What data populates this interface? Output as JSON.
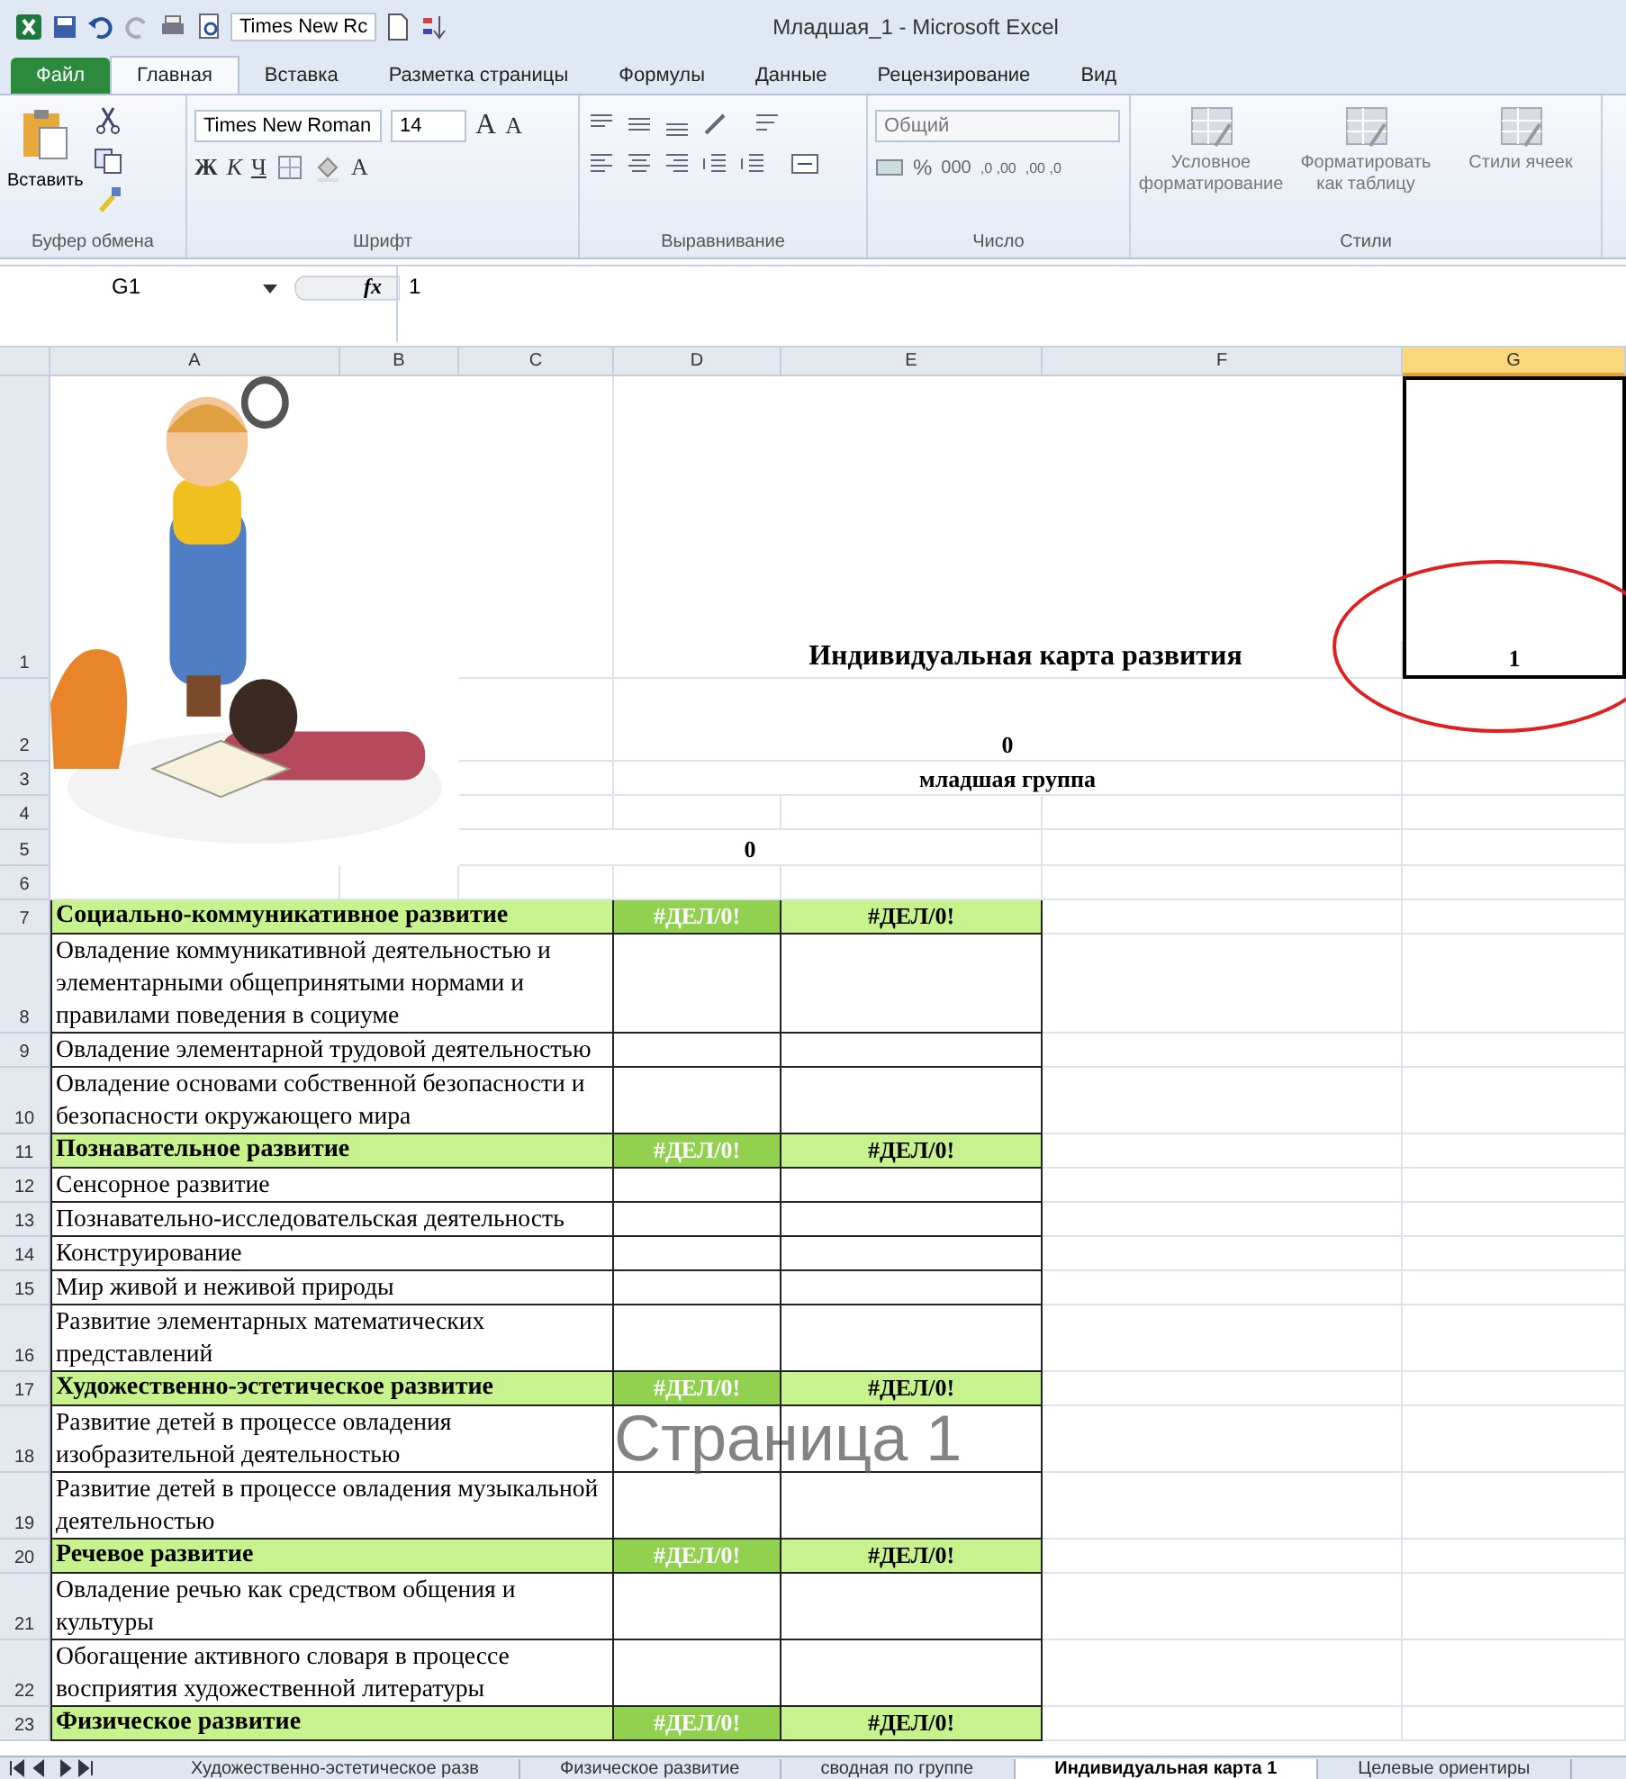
{
  "window": {
    "title": "Младшая_1 - Microsoft Excel",
    "font_box": "Times New Rc"
  },
  "ribbon_tabs": [
    {
      "label": "Файл",
      "kind": "file",
      "selected": false
    },
    {
      "label": "Главная",
      "kind": "tab",
      "selected": true
    },
    {
      "label": "Вставка",
      "kind": "tab",
      "selected": false
    },
    {
      "label": "Разметка страницы",
      "kind": "tab",
      "selected": false
    },
    {
      "label": "Формулы",
      "kind": "tab",
      "selected": false
    },
    {
      "label": "Данные",
      "kind": "tab",
      "selected": false
    },
    {
      "label": "Рецензирование",
      "kind": "tab",
      "selected": false
    },
    {
      "label": "Вид",
      "kind": "tab",
      "selected": false
    }
  ],
  "clipboard": {
    "paste": "Вставить",
    "label": "Буфер обмена"
  },
  "font": {
    "name": "Times New Roman",
    "size": "14",
    "grow": "A",
    "shrink": "A",
    "bold": "Ж",
    "italic": "К",
    "underline": "Ч",
    "font_color_button": "A",
    "label": "Шрифт"
  },
  "alignment": {
    "label": "Выравнивание"
  },
  "number": {
    "format": "Общий",
    "percent": "%",
    "thousands": "000",
    "increase_decimal": ",0 ,00",
    "decrease_decimal": ",00 ,0",
    "label": "Число"
  },
  "styles": {
    "buttons": [
      "Условное форматирование",
      "Форматировать как таблицу",
      "Стили ячеек"
    ],
    "label": "Стили"
  },
  "formula_bar": {
    "name_box": "G1",
    "fx": "fx",
    "value": "1"
  },
  "columns": [
    {
      "label": "A",
      "selected": false
    },
    {
      "label": "B",
      "selected": false
    },
    {
      "label": "C",
      "selected": false
    },
    {
      "label": "D",
      "selected": false
    },
    {
      "label": "E",
      "selected": false
    },
    {
      "label": "F",
      "selected": false
    },
    {
      "label": "G",
      "selected": true
    }
  ],
  "row_numbers": [
    "1",
    "2",
    "3",
    "4",
    "5",
    "6",
    "7",
    "8",
    "9",
    "10",
    "11",
    "12",
    "13",
    "14",
    "15",
    "16",
    "17",
    "18",
    "19",
    "20",
    "21",
    "22",
    "23"
  ],
  "header_block": {
    "title": "Индивидуальная карта развития",
    "line_2": "0",
    "group": "младшая группа",
    "line_5": "0",
    "active_cell": "1"
  },
  "table": [
    {
      "kind": "section",
      "label": "Социально-коммуникативное развитие",
      "col_d": "#ДЕЛ/0!",
      "col_e": "#ДЕЛ/0!"
    },
    {
      "kind": "item",
      "label": "Овладение коммуникативной деятельностью и элементарными общепринятыми нормами и правилами поведения в социуме"
    },
    {
      "kind": "item",
      "label": "Овладение элементарной трудовой деятельностью"
    },
    {
      "kind": "item",
      "label": "Овладение основами собственной безопасности и безопасности окружающего мира"
    },
    {
      "kind": "section",
      "label": "Познавательное развитие",
      "col_d": "#ДЕЛ/0!",
      "col_e": "#ДЕЛ/0!"
    },
    {
      "kind": "item",
      "label": "Сенсорное развитие"
    },
    {
      "kind": "item",
      "label": "Познавательно-исследовательская деятельность"
    },
    {
      "kind": "item",
      "label": "Конструирование"
    },
    {
      "kind": "item",
      "label": "Мир живой и неживой природы"
    },
    {
      "kind": "item",
      "label": "Развитие элементарных математических представлений"
    },
    {
      "kind": "section",
      "label": "Художественно-эстетическое развитие",
      "col_d": "#ДЕЛ/0!",
      "col_e": "#ДЕЛ/0!"
    },
    {
      "kind": "item",
      "label": "Развитие детей в процессе овладения изобразительной деятельностью"
    },
    {
      "kind": "item",
      "label": "Развитие детей в процессе овладения музыкальной деятельностью"
    },
    {
      "kind": "section",
      "label": "Речевое развитие",
      "col_d": "#ДЕЛ/0!",
      "col_e": "#ДЕЛ/0!"
    },
    {
      "kind": "item",
      "label": "Овладение речью как средством общения и культуры"
    },
    {
      "kind": "item",
      "label": "Обогащение   активного словаря в процессе восприятия  художественной литературы"
    },
    {
      "kind": "section",
      "label": "Физическое развитие",
      "col_d": "#ДЕЛ/0!",
      "col_e": "#ДЕЛ/0!"
    }
  ],
  "page_label": "Страница 1",
  "sheet_tabs": [
    {
      "label": "Художественно-эстетическое разв",
      "selected": false
    },
    {
      "label": "Физическое развитие",
      "selected": false
    },
    {
      "label": "сводная по группе",
      "selected": false
    },
    {
      "label": "Индивидуальная карта  1",
      "selected": true
    },
    {
      "label": "Целевые ориентиры",
      "selected": false
    }
  ]
}
